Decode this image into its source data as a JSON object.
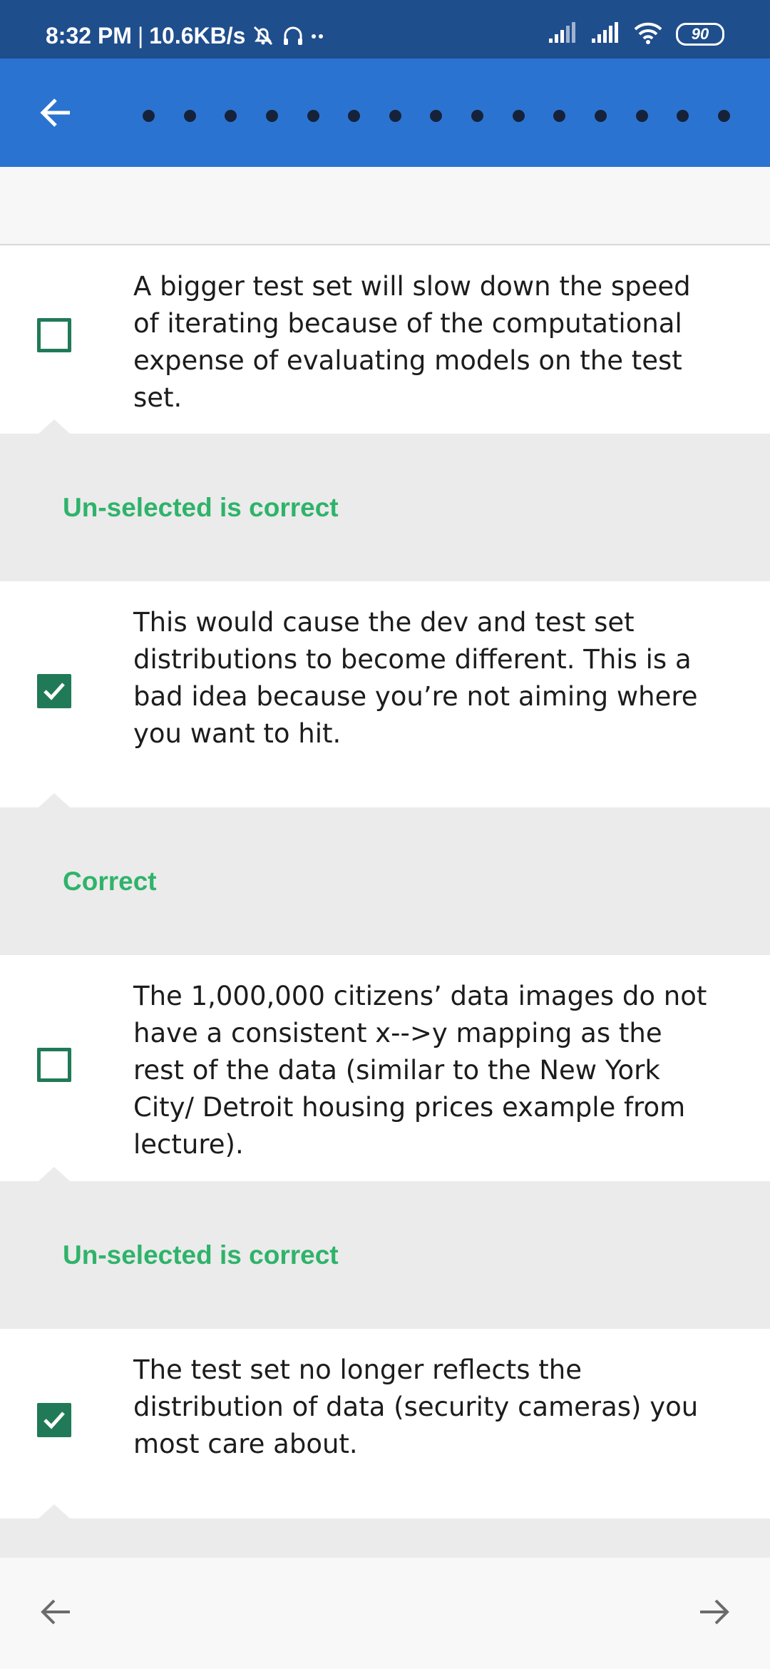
{
  "status_bar": {
    "time": "8:32 PM",
    "separator": "|",
    "speed": "10.6KB/s",
    "battery": "90"
  },
  "icons": {
    "back": "arrow-left-icon",
    "previous": "arrow-left-icon",
    "next": "arrow-right-icon",
    "checked": "checkmark-icon"
  },
  "colors": {
    "status_bar": "#1f4e8c",
    "app_bar": "#2b73d0",
    "checkbox": "#207a57",
    "feedback_text": "#2fb36a",
    "feedback_bg": "#ebebeb"
  },
  "progress": {
    "total_dots": 15
  },
  "options": [
    {
      "text": "A bigger test set will slow down the speed of iterating because of the computational expense of evaluating models on the test set.",
      "checked": false,
      "feedback": "Un-selected is correct"
    },
    {
      "text": "This would cause the dev and test set distributions to become different. This is a bad idea because you’re not aiming where you want to hit.",
      "checked": true,
      "feedback": "Correct"
    },
    {
      "text": "The 1,000,000 citizens’ data images do not have a consistent x-->y mapping as the rest of the data (similar to the New York City/ Detroit housing prices example from lecture).",
      "checked": false,
      "feedback": "Un-selected is correct"
    },
    {
      "text": "The test set no longer reflects the distribution of data (security cameras) you most care about.",
      "checked": true,
      "feedback": ""
    }
  ]
}
